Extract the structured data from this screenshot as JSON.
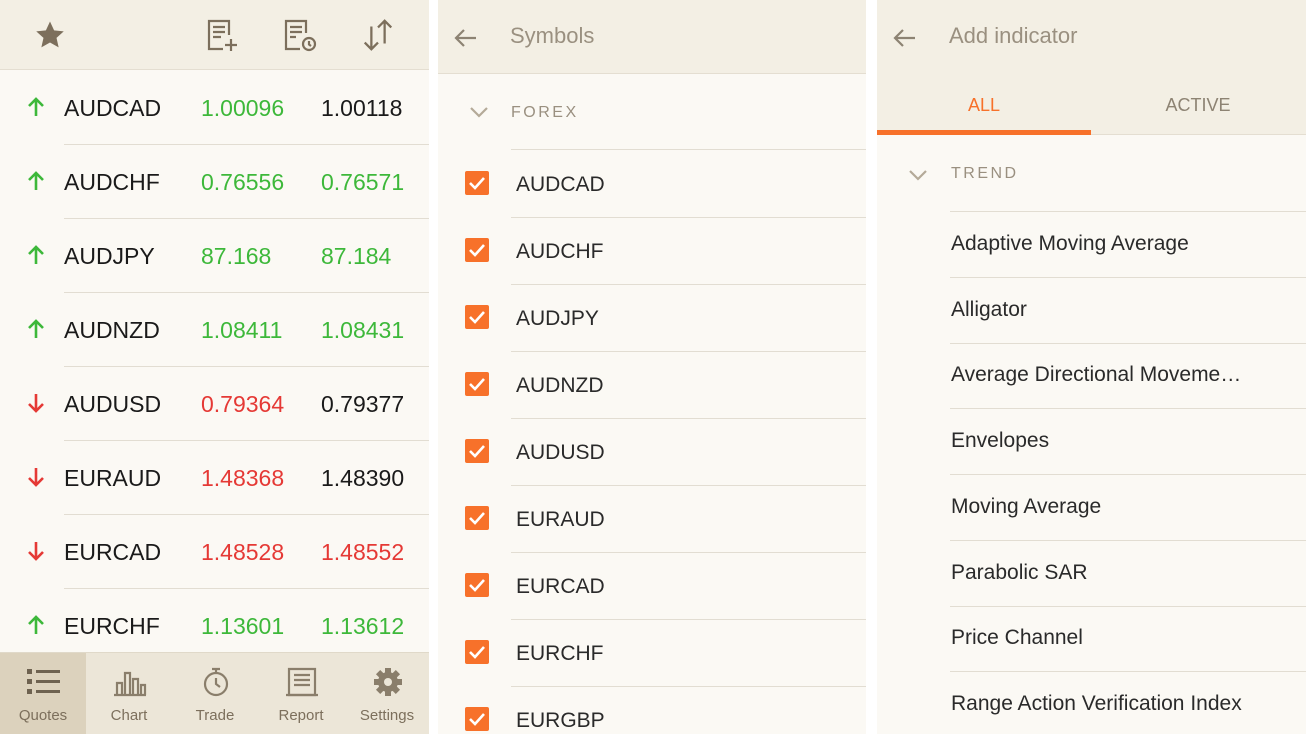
{
  "quotes_panel": {
    "header_icons": [
      "star-icon",
      "add-list-icon",
      "list-history-icon",
      "sort-icon"
    ],
    "rows": [
      {
        "symbol": "AUDCAD",
        "direction": "up",
        "bid": "1.00096",
        "ask": "1.00118",
        "bid_color": "up",
        "ask_color": "neutral"
      },
      {
        "symbol": "AUDCHF",
        "direction": "up",
        "bid": "0.76556",
        "ask": "0.76571",
        "bid_color": "up",
        "ask_color": "up"
      },
      {
        "symbol": "AUDJPY",
        "direction": "up",
        "bid": "87.168",
        "ask": "87.184",
        "bid_color": "up",
        "ask_color": "up"
      },
      {
        "symbol": "AUDNZD",
        "direction": "up",
        "bid": "1.08411",
        "ask": "1.08431",
        "bid_color": "up",
        "ask_color": "up"
      },
      {
        "symbol": "AUDUSD",
        "direction": "down",
        "bid": "0.79364",
        "ask": "0.79377",
        "bid_color": "down",
        "ask_color": "neutral"
      },
      {
        "symbol": "EURAUD",
        "direction": "down",
        "bid": "1.48368",
        "ask": "1.48390",
        "bid_color": "down",
        "ask_color": "neutral"
      },
      {
        "symbol": "EURCAD",
        "direction": "down",
        "bid": "1.48528",
        "ask": "1.48552",
        "bid_color": "down",
        "ask_color": "down"
      },
      {
        "symbol": "EURCHF",
        "direction": "up",
        "bid": "1.13601",
        "ask": "1.13612",
        "bid_color": "up",
        "ask_color": "up"
      }
    ],
    "nav": [
      {
        "label": "Quotes",
        "icon": "list-icon",
        "active": true
      },
      {
        "label": "Chart",
        "icon": "bar-chart-icon",
        "active": false
      },
      {
        "label": "Trade",
        "icon": "stopwatch-icon",
        "active": false
      },
      {
        "label": "Report",
        "icon": "report-icon",
        "active": false
      },
      {
        "label": "Settings",
        "icon": "gear-icon",
        "active": false
      }
    ]
  },
  "symbols_panel": {
    "title": "Symbols",
    "section": "FOREX",
    "symbols": [
      {
        "name": "AUDCAD",
        "checked": true
      },
      {
        "name": "AUDCHF",
        "checked": true
      },
      {
        "name": "AUDJPY",
        "checked": true
      },
      {
        "name": "AUDNZD",
        "checked": true
      },
      {
        "name": "AUDUSD",
        "checked": true
      },
      {
        "name": "EURAUD",
        "checked": true
      },
      {
        "name": "EURCAD",
        "checked": true
      },
      {
        "name": "EURCHF",
        "checked": true
      },
      {
        "name": "EURGBP",
        "checked": true
      }
    ]
  },
  "indicator_panel": {
    "title": "Add indicator",
    "tabs": [
      {
        "label": "ALL",
        "active": true
      },
      {
        "label": "ACTIVE",
        "active": false
      }
    ],
    "section": "TREND",
    "indicators": [
      "Adaptive Moving Average",
      "Alligator",
      "Average Directional Moveme…",
      "Envelopes",
      "Moving Average",
      "Parabolic SAR",
      "Price Channel",
      "Range Action Verification Index"
    ]
  },
  "colors": {
    "accent": "#f7712a",
    "up": "#3db83a",
    "down": "#e53935",
    "header_bg": "#f3efe4",
    "panel_bg": "#fbf9f4"
  }
}
